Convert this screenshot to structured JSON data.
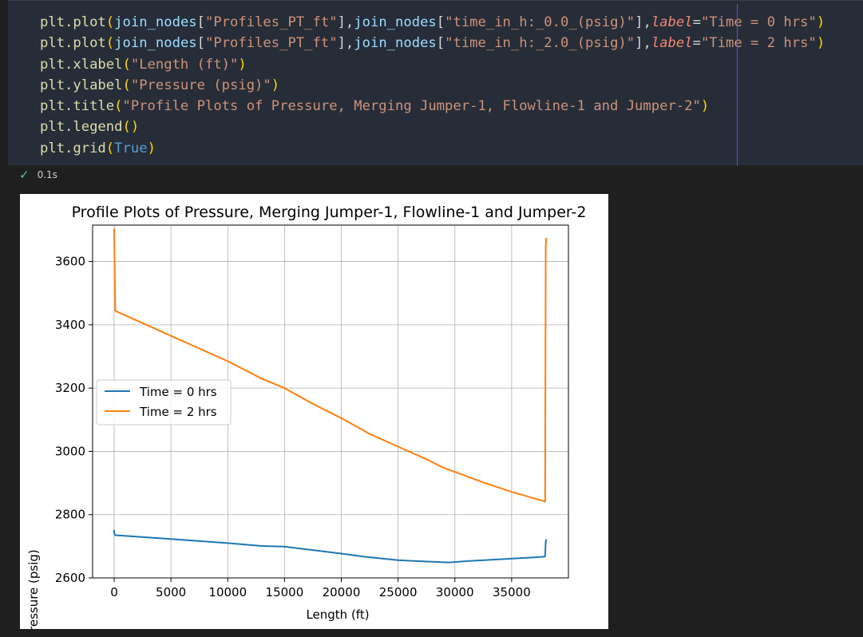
{
  "code": {
    "lines": [
      {
        "fn": "plt.plot",
        "arg1": "join_nodes",
        "key1": "\"Profiles_PT_ft\"",
        "arg2": "join_nodes",
        "key2": "\"time_in_h:_0.0_(psig)\"",
        "kw": "label",
        "val": "\"Time = 0 hrs\""
      },
      {
        "fn": "plt.plot",
        "arg1": "join_nodes",
        "key1": "\"Profiles_PT_ft\"",
        "arg2": "join_nodes",
        "key2": "\"time_in_h:_2.0_(psig)\"",
        "kw": "label",
        "val": "\"Time = 2 hrs\""
      }
    ],
    "xlabel_line": {
      "fn": "plt.xlabel",
      "arg": "\"Length (ft)\""
    },
    "ylabel_line": {
      "fn": "plt.ylabel",
      "arg": "\"Pressure (psig)\""
    },
    "title_line": {
      "fn": "plt.title",
      "arg": "\"Profile Plots of Pressure, Merging Jumper-1, Flowline-1 and Jumper-2\""
    },
    "legend_line": {
      "fn": "plt.legend"
    },
    "grid_line": {
      "fn": "plt.grid",
      "arg": "True"
    }
  },
  "status": {
    "icon": "check-icon",
    "duration": "0.1s"
  },
  "colors": {
    "series0": "#1f77b4",
    "series1": "#ff7f0e",
    "grid": "#b0b0b0"
  },
  "chart_data": {
    "type": "line",
    "title": "Profile Plots of Pressure, Merging Jumper-1, Flowline-1 and Jumper-2",
    "xlabel": "Length (ft)",
    "ylabel": "Pressure (psig)",
    "xlim": [
      -1900,
      40000
    ],
    "ylim": [
      2600,
      3715
    ],
    "xticks": [
      0,
      5000,
      10000,
      15000,
      20000,
      25000,
      30000,
      35000
    ],
    "yticks": [
      2600,
      2800,
      3000,
      3200,
      3400,
      3600
    ],
    "grid": true,
    "legend_position": "center-left",
    "series": [
      {
        "name": "Time = 0 hrs",
        "color": "#1f77b4",
        "x": [
          0,
          0,
          50,
          150,
          5000,
          10000,
          13000,
          15000,
          17000,
          20000,
          22000,
          25000,
          28000,
          29500,
          31000,
          34000,
          37000,
          37900,
          37950,
          38000,
          38050
        ],
        "y": [
          2752,
          2745,
          2736,
          2735,
          2723,
          2710,
          2701,
          2699,
          2690,
          2677,
          2667,
          2656,
          2651,
          2649,
          2653,
          2659,
          2665,
          2667,
          2669,
          2715,
          2722
        ]
      },
      {
        "name": "Time = 2 hrs",
        "color": "#ff7f0e",
        "x": [
          0,
          0,
          100,
          150,
          5000,
          10000,
          13000,
          15000,
          17500,
          20000,
          22500,
          25000,
          27500,
          29000,
          30000,
          32500,
          35000,
          37900,
          37950,
          38000,
          38050
        ],
        "y": [
          3704,
          3695,
          3445,
          3443,
          3365,
          3285,
          3230,
          3200,
          3150,
          3105,
          3055,
          3015,
          2975,
          2948,
          2935,
          2902,
          2872,
          2842,
          2841,
          3650,
          3675
        ]
      }
    ]
  }
}
